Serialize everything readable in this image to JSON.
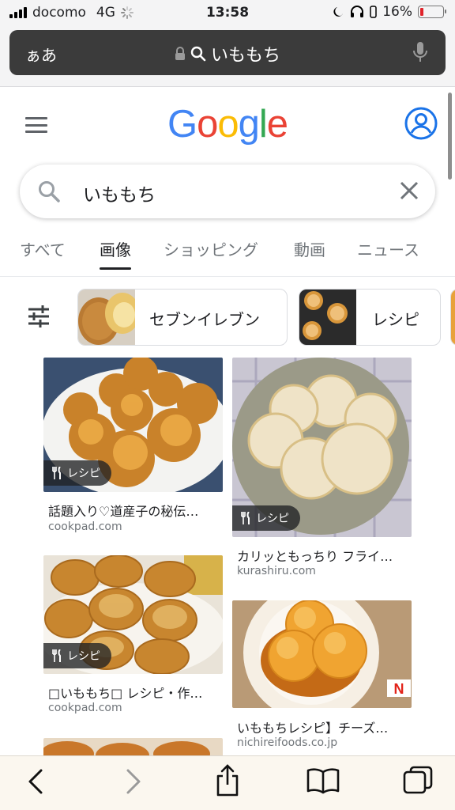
{
  "status_bar": {
    "carrier": "docomo",
    "network": "4G",
    "time": "13:58",
    "battery_percent": "16%",
    "battery_level": 0.16,
    "battery_color": "#e0232a"
  },
  "address_bar": {
    "text_size_label": "ぁあ",
    "query": "いももち",
    "icons": [
      "lock-icon",
      "search-icon",
      "microphone-icon"
    ]
  },
  "google": {
    "logo_letters": [
      {
        "char": "G",
        "color": "#4285F4"
      },
      {
        "char": "o",
        "color": "#EA4335"
      },
      {
        "char": "o",
        "color": "#FBBC05"
      },
      {
        "char": "g",
        "color": "#4285F4"
      },
      {
        "char": "l",
        "color": "#34A853"
      },
      {
        "char": "e",
        "color": "#EA4335"
      }
    ],
    "accent": "#1a73e8"
  },
  "search": {
    "query": "いももち"
  },
  "tabs": [
    {
      "label": "すべて",
      "active": false
    },
    {
      "label": "画像",
      "active": true
    },
    {
      "label": "ショッピング",
      "active": false
    },
    {
      "label": "動画",
      "active": false
    },
    {
      "label": "ニュース",
      "active": false
    }
  ],
  "chips": [
    {
      "label": "セブンイレブン"
    },
    {
      "label": "レシピ"
    }
  ],
  "results": [
    {
      "badge": "レシピ",
      "title": "話題入り♡道産子の秘伝…",
      "domain": "cookpad.com"
    },
    {
      "badge": "レシピ",
      "title": "カリッともっちり フライ…",
      "domain": "kurashiru.com"
    },
    {
      "badge": "レシピ",
      "title": "□いももち□ レシピ・作…",
      "domain": "cookpad.com"
    },
    {
      "badge": "",
      "title": "いももちレシピ】チーズ…",
      "domain": "nichireifoods.co.jp"
    }
  ],
  "toolbar": {
    "icons": [
      "back-icon",
      "forward-icon",
      "share-icon",
      "bookmarks-icon",
      "tabs-icon"
    ]
  }
}
